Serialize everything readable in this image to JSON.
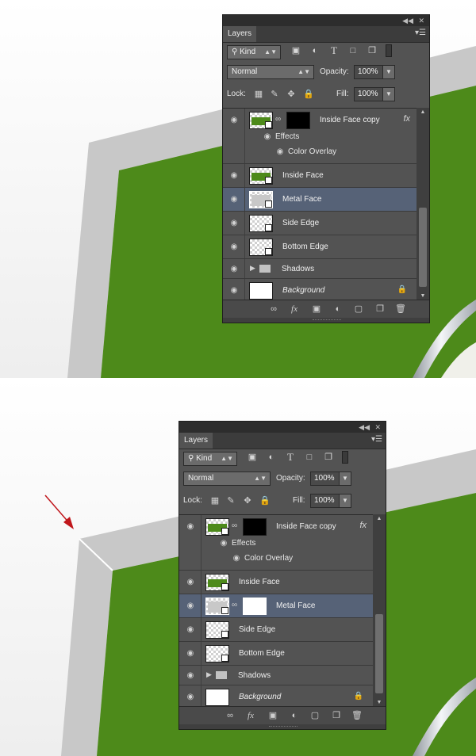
{
  "colors": {
    "green": "#4d8a1a",
    "grey_edge": "#c8c8c8",
    "panel": "#535353",
    "selected": "#566277",
    "arrow": "#c0161b"
  },
  "panels": [
    {
      "tab": "Layers",
      "filter_kind": "Kind",
      "blend_mode": "Normal",
      "opacity_label": "Opacity:",
      "opacity_value": "100%",
      "lock_label": "Lock:",
      "fill_label": "Fill:",
      "fill_value": "100%",
      "layers": {
        "inside_copy": "Inside Face copy",
        "effects": "Effects",
        "color_overlay": "Color Overlay",
        "inside": "Inside Face",
        "metal": "Metal Face",
        "side": "Side Edge",
        "bottom": "Bottom Edge",
        "shadows": "Shadows",
        "background": "Background"
      },
      "fx_label": "fx"
    },
    {
      "tab": "Layers",
      "filter_kind": "Kind",
      "blend_mode": "Normal",
      "opacity_label": "Opacity:",
      "opacity_value": "100%",
      "lock_label": "Lock:",
      "fill_label": "Fill:",
      "fill_value": "100%",
      "layers": {
        "inside_copy": "Inside Face copy",
        "effects": "Effects",
        "color_overlay": "Color Overlay",
        "inside": "Inside Face",
        "metal": "Metal Face",
        "side": "Side Edge",
        "bottom": "Bottom Edge",
        "shadows": "Shadows",
        "background": "Background"
      },
      "fx_label": "fx"
    }
  ]
}
